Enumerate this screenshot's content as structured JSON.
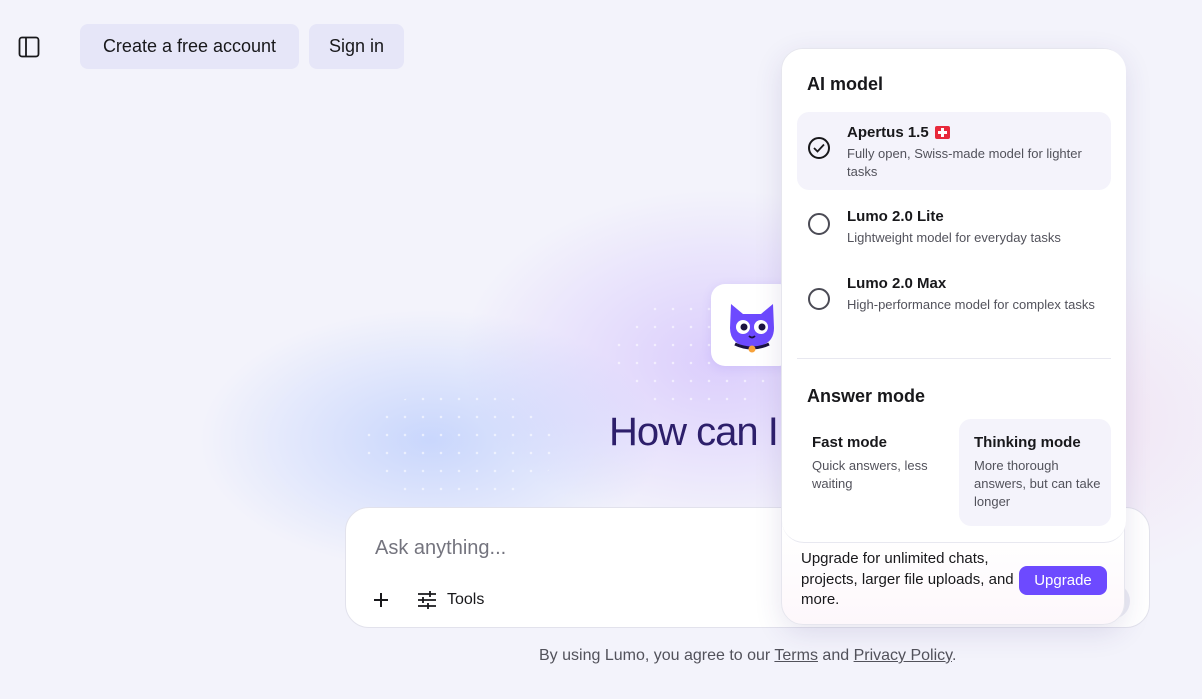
{
  "header": {
    "create_account_label": "Create a free account",
    "sign_in_label": "Sign in"
  },
  "hero": {
    "greeting": "How can I"
  },
  "composer": {
    "placeholder": "Ask anything...",
    "tools_label": "Tools"
  },
  "legal": {
    "prefix": "By using Lumo, you agree to our ",
    "terms_label": "Terms",
    "middle": " and ",
    "privacy_label": "Privacy Policy",
    "suffix": "."
  },
  "model_panel": {
    "ai_model_title": "AI model",
    "models": [
      {
        "name": "Apertus 1.5",
        "description": "Fully open, Swiss-made model for lighter tasks",
        "selected": true,
        "flag": "swiss-flag-icon"
      },
      {
        "name": "Lumo 2.0 Lite",
        "description": "Lightweight model for everyday tasks",
        "selected": false
      },
      {
        "name": "Lumo 2.0 Max",
        "description": "High-performance model for complex tasks",
        "selected": false
      }
    ],
    "answer_mode_title": "Answer mode",
    "modes": [
      {
        "title": "Fast mode",
        "description": "Quick answers, less waiting",
        "active": false
      },
      {
        "title": "Thinking mode",
        "description": "More thorough answers, but can take longer",
        "active": true
      }
    ],
    "upgrade_text": "Upgrade for unlimited chats, projects, larger file uploads, and more.",
    "upgrade_label": "Upgrade"
  },
  "colors": {
    "accent": "#6d4aff",
    "hero_text": "#2d1f6b",
    "background": "#f3f3fb"
  }
}
